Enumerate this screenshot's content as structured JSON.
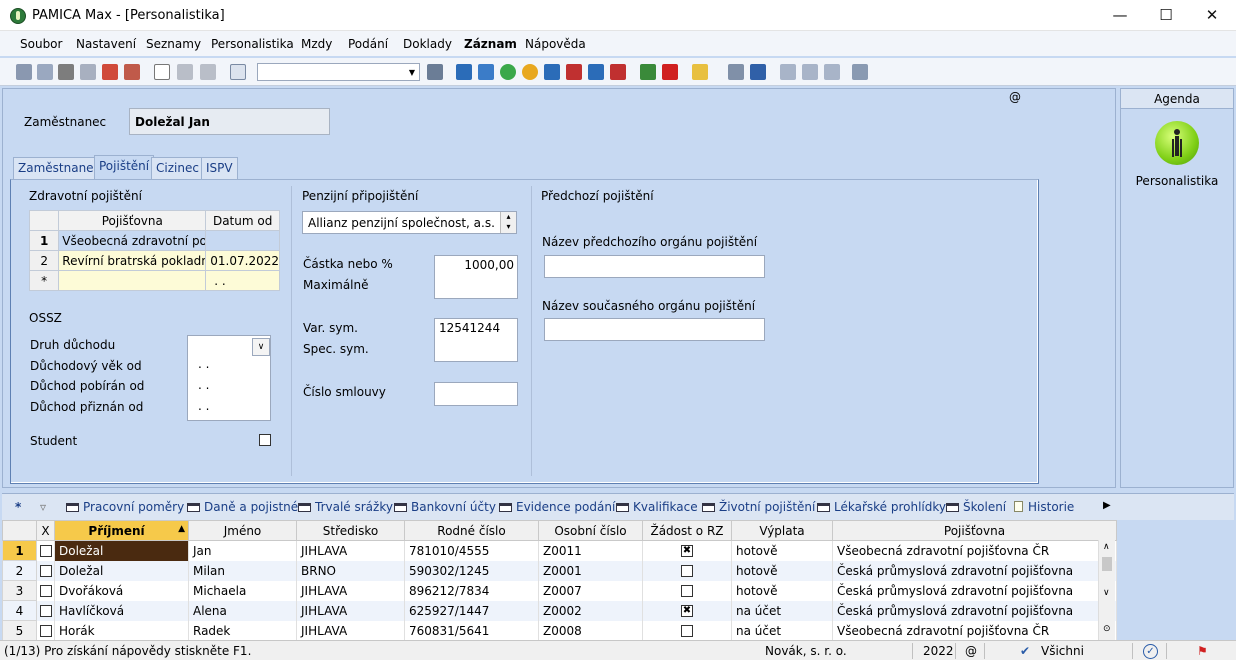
{
  "window": {
    "title": "PAMICA Max - [Personalistika]"
  },
  "menu": [
    "Soubor",
    "Nastavení",
    "Seznamy",
    "Personalistika",
    "Mzdy",
    "Podání",
    "Doklady",
    "Záznam",
    "Nápověda"
  ],
  "header": {
    "employee_label": "Zaměstnanec",
    "employee_value": "Doležal Jan",
    "at_sign": "@"
  },
  "tabs": [
    "Zaměstnanec",
    "Pojištění",
    "Cizinec",
    "ISPV"
  ],
  "health": {
    "section": "Zdravotní pojištění",
    "col_insurer": "Pojišťovna",
    "col_date": "Datum od",
    "rows": [
      {
        "n": "1",
        "insurer": "Všeobecná zdravotní pojišť",
        "date": ""
      },
      {
        "n": "2",
        "insurer": "Revírní bratrská pokladna, z",
        "date": "01.07.2022"
      },
      {
        "n": "*",
        "insurer": "",
        "date": ". ."
      }
    ]
  },
  "ossz": {
    "section": "OSSZ",
    "pension_type": "Druh důchodu",
    "pension_age": "Důchodový věk od",
    "pension_received": "Důchod pobírán od",
    "pension_granted": "Důchod přiznán od",
    "date_placeholder": ". .",
    "student": "Student"
  },
  "pension": {
    "section": "Penzijní připojištění",
    "company": "Allianz penzijní společnost, a.s.",
    "amount_label": "Částka nebo %",
    "max_label": "Maximálně",
    "amount": "1000,00",
    "var_sym_label": "Var. sym.",
    "spec_sym_label": "Spec. sym.",
    "var_sym": "12541244",
    "contract_label": "Číslo smlouvy"
  },
  "previous": {
    "section": "Předchozí pojištění",
    "prev_org_label": "Název předchozího orgánu pojištění",
    "curr_org_label": "Název současného orgánu pojištění"
  },
  "agenda": {
    "title": "Agenda",
    "item": "Personalistika"
  },
  "bottom_tabs": [
    "Pracovní poměry",
    "Daně a pojistné",
    "Trvalé srážky",
    "Bankovní účty",
    "Evidence podání",
    "Kvalifikace",
    "Životní pojištění",
    "Lékařské prohlídky",
    "Školení",
    "Historie"
  ],
  "grid": {
    "columns": {
      "x": "X",
      "surname": "Příjmení",
      "name": "Jméno",
      "center": "Středisko",
      "birth": "Rodné číslo",
      "personal": "Osobní číslo",
      "request": "Žádost o RZ",
      "payment": "Výplata",
      "insurer": "Pojišťovna"
    },
    "rows": [
      {
        "n": "1",
        "surname": "Doležal",
        "name": "Jan",
        "center": "JIHLAVA",
        "birth": "781010/4555",
        "personal": "Z0011",
        "request": true,
        "payment": "hotově",
        "insurer": "Všeobecná zdravotní pojišťovna ČR"
      },
      {
        "n": "2",
        "surname": "Doležal",
        "name": "Milan",
        "center": "BRNO",
        "birth": "590302/1245",
        "personal": "Z0001",
        "request": false,
        "payment": "hotově",
        "insurer": "Česká průmyslová zdravotní pojišťovna"
      },
      {
        "n": "3",
        "surname": "Dvořáková",
        "name": "Michaela",
        "center": "JIHLAVA",
        "birth": "896212/7834",
        "personal": "Z0007",
        "request": false,
        "payment": "hotově",
        "insurer": "Česká průmyslová zdravotní pojišťovna"
      },
      {
        "n": "4",
        "surname": "Havlíčková",
        "name": "Alena",
        "center": "JIHLAVA",
        "birth": "625927/1447",
        "personal": "Z0002",
        "request": true,
        "payment": "na účet",
        "insurer": "Česká průmyslová zdravotní pojišťovna"
      },
      {
        "n": "5",
        "surname": "Horák",
        "name": "Radek",
        "center": "JIHLAVA",
        "birth": "760831/5641",
        "personal": "Z0008",
        "request": false,
        "payment": "na účet",
        "insurer": "Všeobecná zdravotní pojišťovna ČR"
      }
    ]
  },
  "status": {
    "help": "(1/13) Pro získání nápovědy stiskněte F1.",
    "company": "Novák, s. r. o.",
    "year": "2022",
    "at": "@",
    "filter": "Všichni"
  },
  "colors": {
    "panel": "#c7d9f2",
    "selected_row": "#4a2a10",
    "sorted_header": "#f6c94a",
    "highlight_row": "#fdfbd7"
  }
}
